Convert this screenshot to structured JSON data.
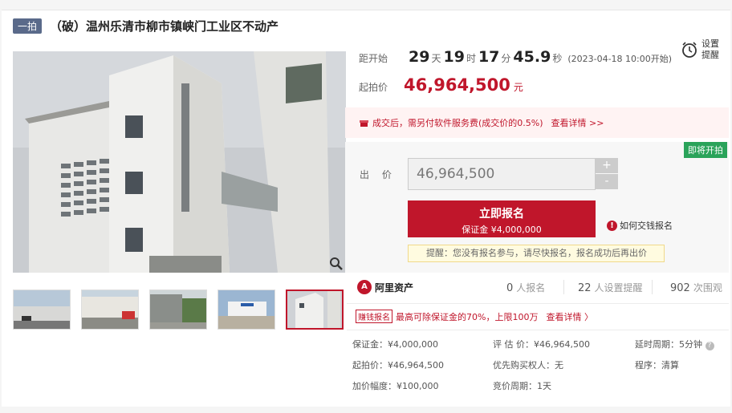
{
  "header": {
    "tag": "一拍",
    "title": "（破）温州乐清市柳市镇峡门工业区不动产"
  },
  "countdown": {
    "label": "距开始",
    "days": "29",
    "days_unit": "天",
    "hours": "19",
    "hours_unit": "时",
    "minutes": "17",
    "minutes_unit": "分",
    "seconds": "45.9",
    "seconds_unit": "秒",
    "start_note": "(2023-04-18 10:00开始)"
  },
  "reminder": {
    "line1": "设置",
    "line2": "提醒",
    "icon": "alarm-clock-icon"
  },
  "start_price": {
    "label": "起拍价",
    "value": "46,964,500",
    "unit": "元"
  },
  "notice": {
    "text": "成交后，需另付软件服务费(成交价的0.5%)",
    "link": "查看详情 >>"
  },
  "bid": {
    "badge": "即将开拍",
    "label": "出 价",
    "value": "46,964,500",
    "plus": "+",
    "minus": "-",
    "apply_label": "立即报名",
    "apply_sub": "保证金 ¥4,000,000",
    "howto": "如何交钱报名",
    "tip": "提醒：您没有报名参与，请尽快报名，报名成功后再出价"
  },
  "stats": {
    "provider": "阿里资产",
    "signups": "0",
    "signups_label": "人报名",
    "reminders": "22",
    "reminders_label": "人设置提醒",
    "views": "902",
    "views_label": "次围观"
  },
  "promo": {
    "badge": "赚钱报名",
    "text": "最高可除保证金的70%，上限100万",
    "link": "查看详情 〉"
  },
  "details": {
    "col1": [
      "保证金：¥4,000,000",
      "起拍价：¥46,964,500",
      "加价幅度：¥100,000"
    ],
    "col2": [
      "评 估 价：¥46,964,500",
      "优先购买权人：无",
      "竞价周期：1天"
    ],
    "col3": [
      "延时周期：5分钟",
      "程序：清算"
    ]
  },
  "colors": {
    "accent": "#c0162b",
    "tag_bg": "#5a6a8a",
    "badge_green": "#2aa35a"
  }
}
